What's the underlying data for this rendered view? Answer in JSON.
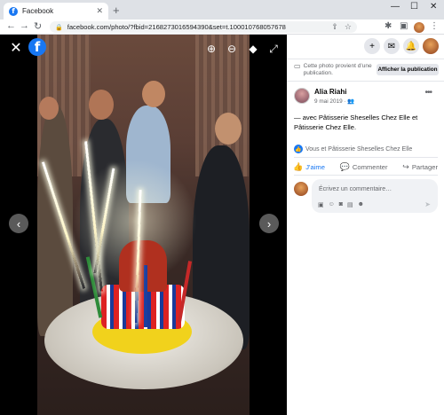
{
  "browser": {
    "tab_title": "Facebook",
    "url": "facebook.com/photo/?fbid=2168273016594390&set=t.100010768057678",
    "new_tab_label": "+"
  },
  "viewer": {
    "close_label": "✕",
    "prev_label": "‹",
    "next_label": "›"
  },
  "panel": {
    "notice_text": "Cette photo provient d'une publication.",
    "show_publication_label": "Afficher la publication",
    "author_name": "Alia Riahi",
    "post_date": "9 mai 2019",
    "caption": "— avec Pâtisserie Sheselles Chez Elle et Pâtisserie Chez Elle.",
    "reactions_text": "Vous et Pâtisserie Sheselles Chez Elle",
    "like_label": "J'aime",
    "comment_label": "Commenter",
    "share_label": "Partager",
    "comment_placeholder": "Écrivez un commentaire…"
  },
  "colors": {
    "brand": "#1877f2",
    "viewer_bg": "#000000",
    "button_bg": "#e4e6eb"
  },
  "icons": [
    "facebook-logo-icon",
    "close-icon",
    "zoom-in-icon",
    "zoom-out-icon",
    "tag-icon",
    "fullscreen-icon",
    "plus-icon",
    "messenger-icon",
    "bell-icon",
    "globe-icon",
    "like-icon",
    "comment-icon",
    "share-icon",
    "send-icon"
  ]
}
